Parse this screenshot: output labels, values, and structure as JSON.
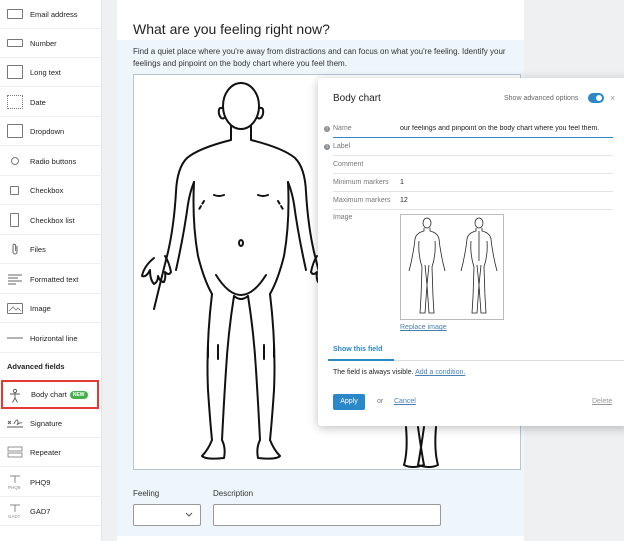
{
  "sidebar": {
    "items": [
      {
        "label": "Email address",
        "icon": "envelope-icon"
      },
      {
        "label": "Number",
        "icon": "number-field-icon"
      },
      {
        "label": "Long text",
        "icon": "long-text-icon"
      },
      {
        "label": "Date",
        "icon": "calendar-icon"
      },
      {
        "label": "Dropdown",
        "icon": "dropdown-icon"
      },
      {
        "label": "Radio buttons",
        "icon": "radio-icon"
      },
      {
        "label": "Checkbox",
        "icon": "checkbox-icon"
      },
      {
        "label": "Checkbox list",
        "icon": "checkbox-list-icon"
      },
      {
        "label": "Files",
        "icon": "paperclip-icon"
      },
      {
        "label": "Formatted text",
        "icon": "formatted-text-icon"
      },
      {
        "label": "Image",
        "icon": "image-icon"
      },
      {
        "label": "Horizontal line",
        "icon": "horizontal-line-icon"
      }
    ],
    "advanced_heading": "Advanced fields",
    "advanced_items": [
      {
        "label": "Body chart",
        "badge": "NEW",
        "icon": "body-figure-icon"
      },
      {
        "label": "Signature",
        "icon": "signature-icon"
      },
      {
        "label": "Repeater",
        "icon": "repeater-icon"
      },
      {
        "label": "PHQ9",
        "icon": "phq9-icon",
        "icon_text": "PHQ9"
      },
      {
        "label": "GAD7",
        "icon": "gad7-icon",
        "icon_text": "GAD7"
      }
    ]
  },
  "main": {
    "title": "What are you feeling right now?",
    "description": "Find a quiet place where you're away from distractions and can focus on what you're feeling. Identify your feelings and pinpoint on the body chart where you feel them.",
    "feeling_label": "Feeling",
    "description_label": "Description"
  },
  "popup": {
    "title": "Body chart",
    "advanced_label": "Show advanced options",
    "advanced_on": true,
    "close": "×",
    "name_label": "Name",
    "name_value": "our feelings and pinpoint on the body chart where you feel them.",
    "label_label": "Label",
    "comment_label": "Comment",
    "min_label": "Minimum markers",
    "min_value": "1",
    "max_label": "Maximum markers",
    "max_value": "12",
    "image_label": "Image",
    "replace_link": "Replace image",
    "tab_label": "Show this field",
    "visibility_text": "The field is always visible.",
    "add_condition": "Add a condition.",
    "apply": "Apply",
    "or": "or",
    "cancel": "Cancel",
    "delete": "Delete"
  },
  "colors": {
    "accent": "#2a87c8",
    "badge": "#46b14a",
    "highlight": "#e53935"
  }
}
